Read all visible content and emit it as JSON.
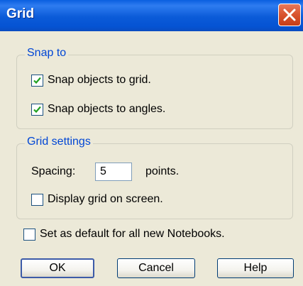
{
  "window": {
    "title": "Grid"
  },
  "snap_group": {
    "legend": "Snap to",
    "items": [
      {
        "label": "Snap objects to grid.",
        "checked": true
      },
      {
        "label": "Snap objects to angles.",
        "checked": true
      }
    ]
  },
  "grid_group": {
    "legend": "Grid settings",
    "spacing_label": "Spacing:",
    "spacing_value": "5",
    "spacing_unit": "points.",
    "display_label": "Display grid on screen.",
    "display_checked": false
  },
  "default_option": {
    "label": "Set as default for all new Notebooks.",
    "checked": false
  },
  "buttons": {
    "ok": "OK",
    "cancel": "Cancel",
    "help": "Help"
  }
}
